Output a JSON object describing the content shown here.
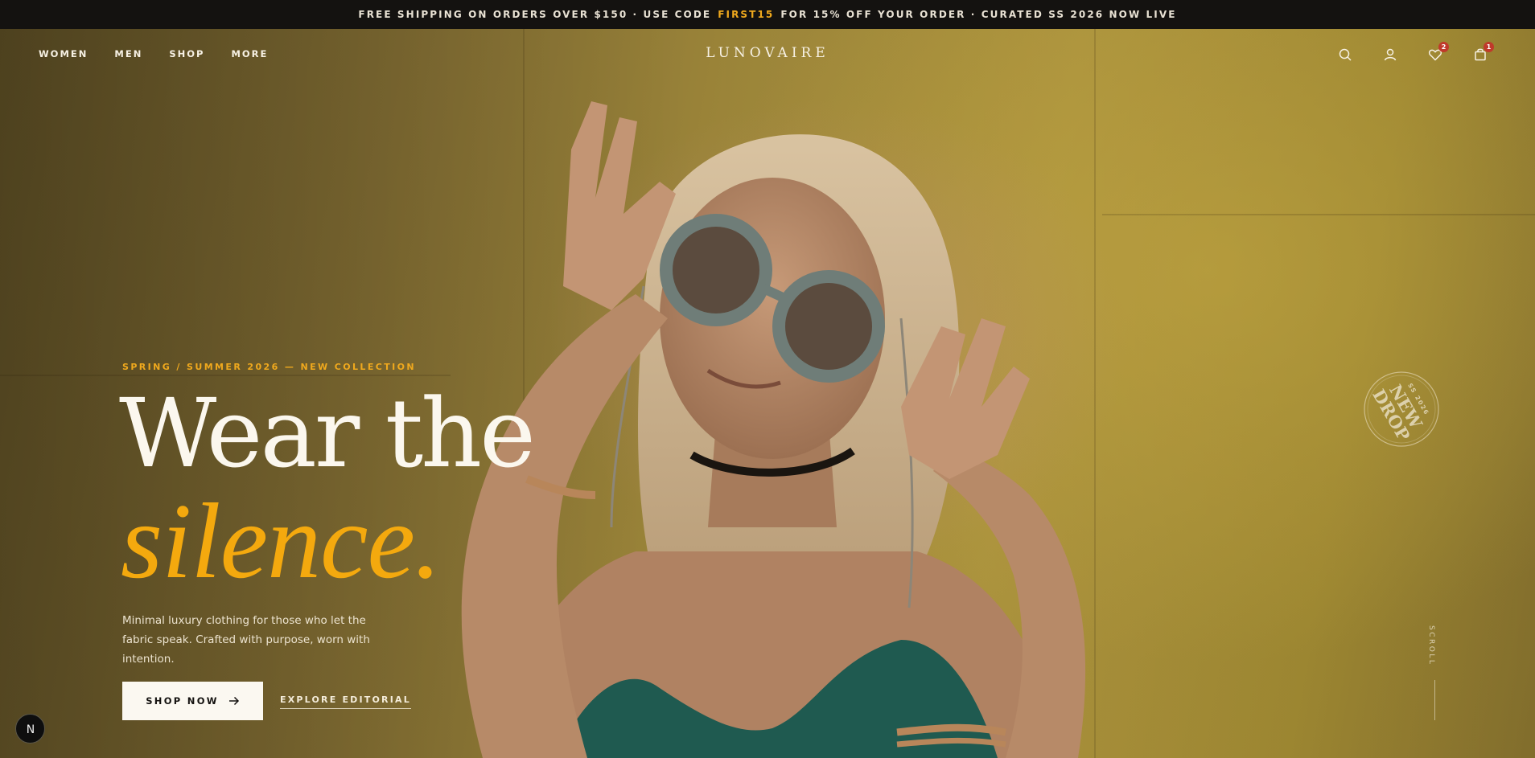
{
  "announcement": {
    "before_code": "FREE SHIPPING ON ORDERS OVER $150 · USE CODE",
    "code": "FIRST15",
    "after_code": "FOR 15% OFF YOUR ORDER · CURATED SS 2026 NOW LIVE"
  },
  "nav": {
    "links": [
      "WOMEN",
      "MEN",
      "SHOP",
      "MORE"
    ],
    "brand": "LUNOVAIRE",
    "icons": [
      "search-icon",
      "user-icon",
      "heart-icon",
      "bag-icon"
    ],
    "wishlist_count": "2",
    "cart_count": "1"
  },
  "hero": {
    "eyebrow": "SPRING / SUMMER 2026 — NEW COLLECTION",
    "headline_line1": "Wear the",
    "headline_line2": "silence.",
    "subcopy": "Minimal luxury clothing for those who let the fabric speak. Crafted with purpose, worn with intention.",
    "primary_cta": "SHOP NOW",
    "secondary_cta": "EXPLORE EDITORIAL",
    "stamp_top": "SS 2026",
    "stamp_line1": "NEW",
    "stamp_line2": "DROP",
    "scroll_label": "SCROLL"
  },
  "corner_badge": "N",
  "colors": {
    "accent": "#f4a90e",
    "announcement_bg": "#141210",
    "badge": "#c0392b",
    "button_bg": "#fbf8f1"
  }
}
